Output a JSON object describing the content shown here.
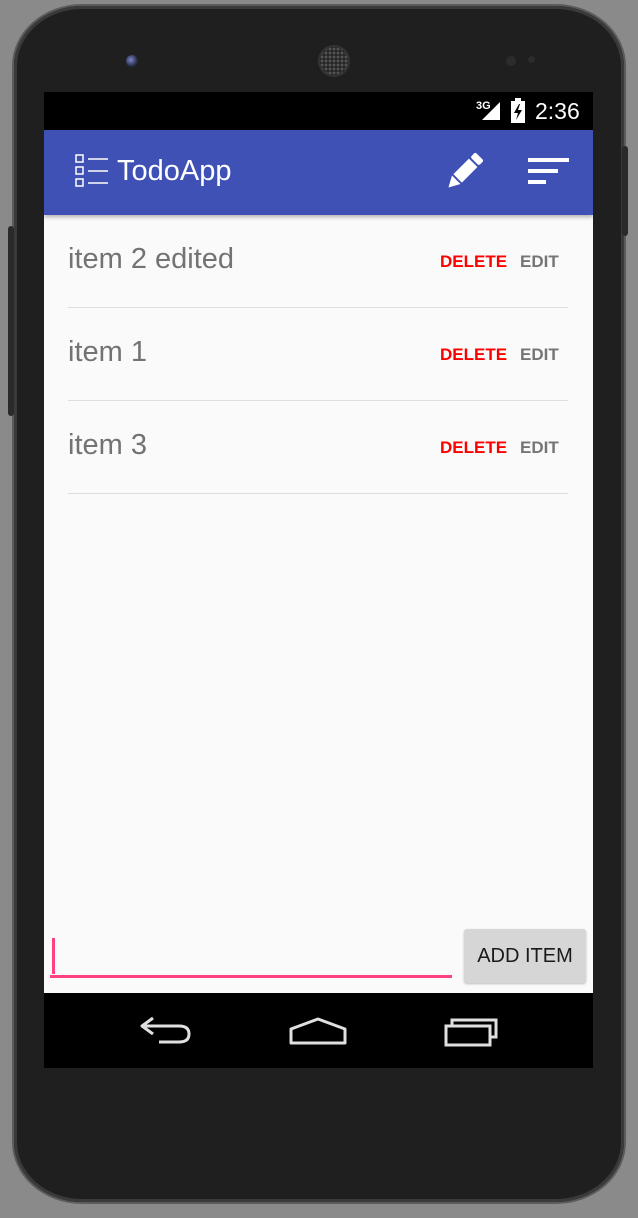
{
  "status_bar": {
    "network": "3G",
    "time": "2:36"
  },
  "app_bar": {
    "title": "TodoApp",
    "color": "#3f51b5",
    "icons": [
      "list-logo-icon",
      "pencil-icon",
      "sort-icon"
    ]
  },
  "items": [
    {
      "text": "item 2 edited",
      "delete_label": "DELETE",
      "edit_label": "EDIT"
    },
    {
      "text": "item 1",
      "delete_label": "DELETE",
      "edit_label": "EDIT"
    },
    {
      "text": "item 3",
      "delete_label": "DELETE",
      "edit_label": "EDIT"
    }
  ],
  "composer": {
    "input_value": "",
    "add_label": "ADD ITEM",
    "accent_color": "#ff4081"
  },
  "colors": {
    "delete": "#ff0000",
    "edit": "#757575"
  },
  "nav_bar": {
    "icons": [
      "back-icon",
      "home-icon",
      "recents-icon"
    ]
  }
}
